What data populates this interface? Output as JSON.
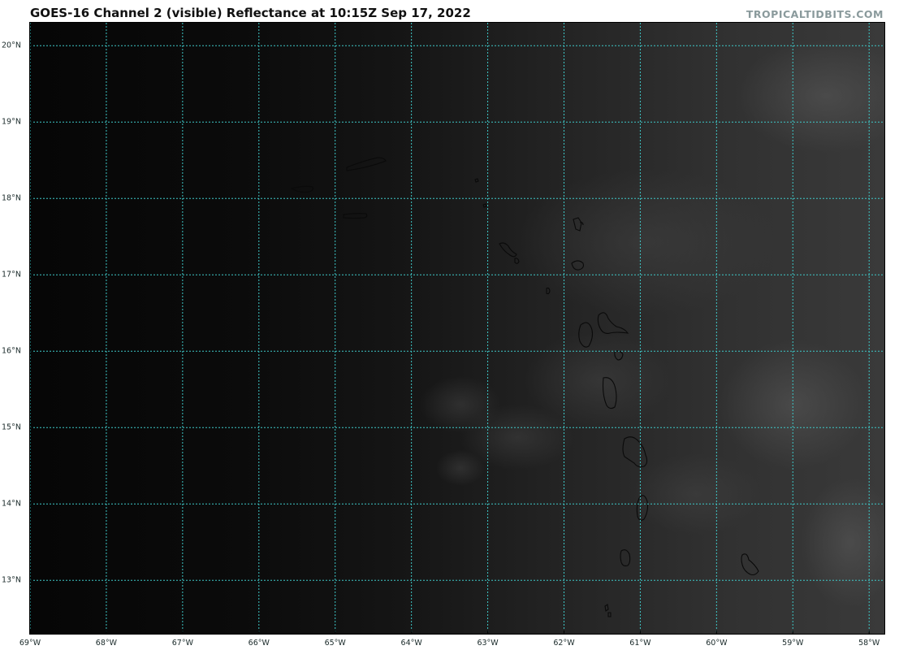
{
  "header": {
    "title": "GOES-16 Channel 2 (visible) Reflectance at 10:15Z Sep 17, 2022",
    "credit": "TROPICALTIDBITS.COM"
  },
  "map": {
    "lon_range": [
      -69,
      -57.8
    ],
    "lat_range": [
      12.3,
      20.3
    ],
    "graticule_color": "#3ec8c8",
    "coast_color": "#0a0a0a",
    "lat_labels": [
      "20°N",
      "19°N",
      "18°N",
      "17°N",
      "16°N",
      "15°N",
      "14°N",
      "13°N"
    ],
    "lon_labels": [
      "69°W",
      "68°W",
      "67°W",
      "66°W",
      "65°W",
      "64°W",
      "63°W",
      "62°W",
      "61°W",
      "60°W",
      "59°W",
      "58°W"
    ]
  }
}
